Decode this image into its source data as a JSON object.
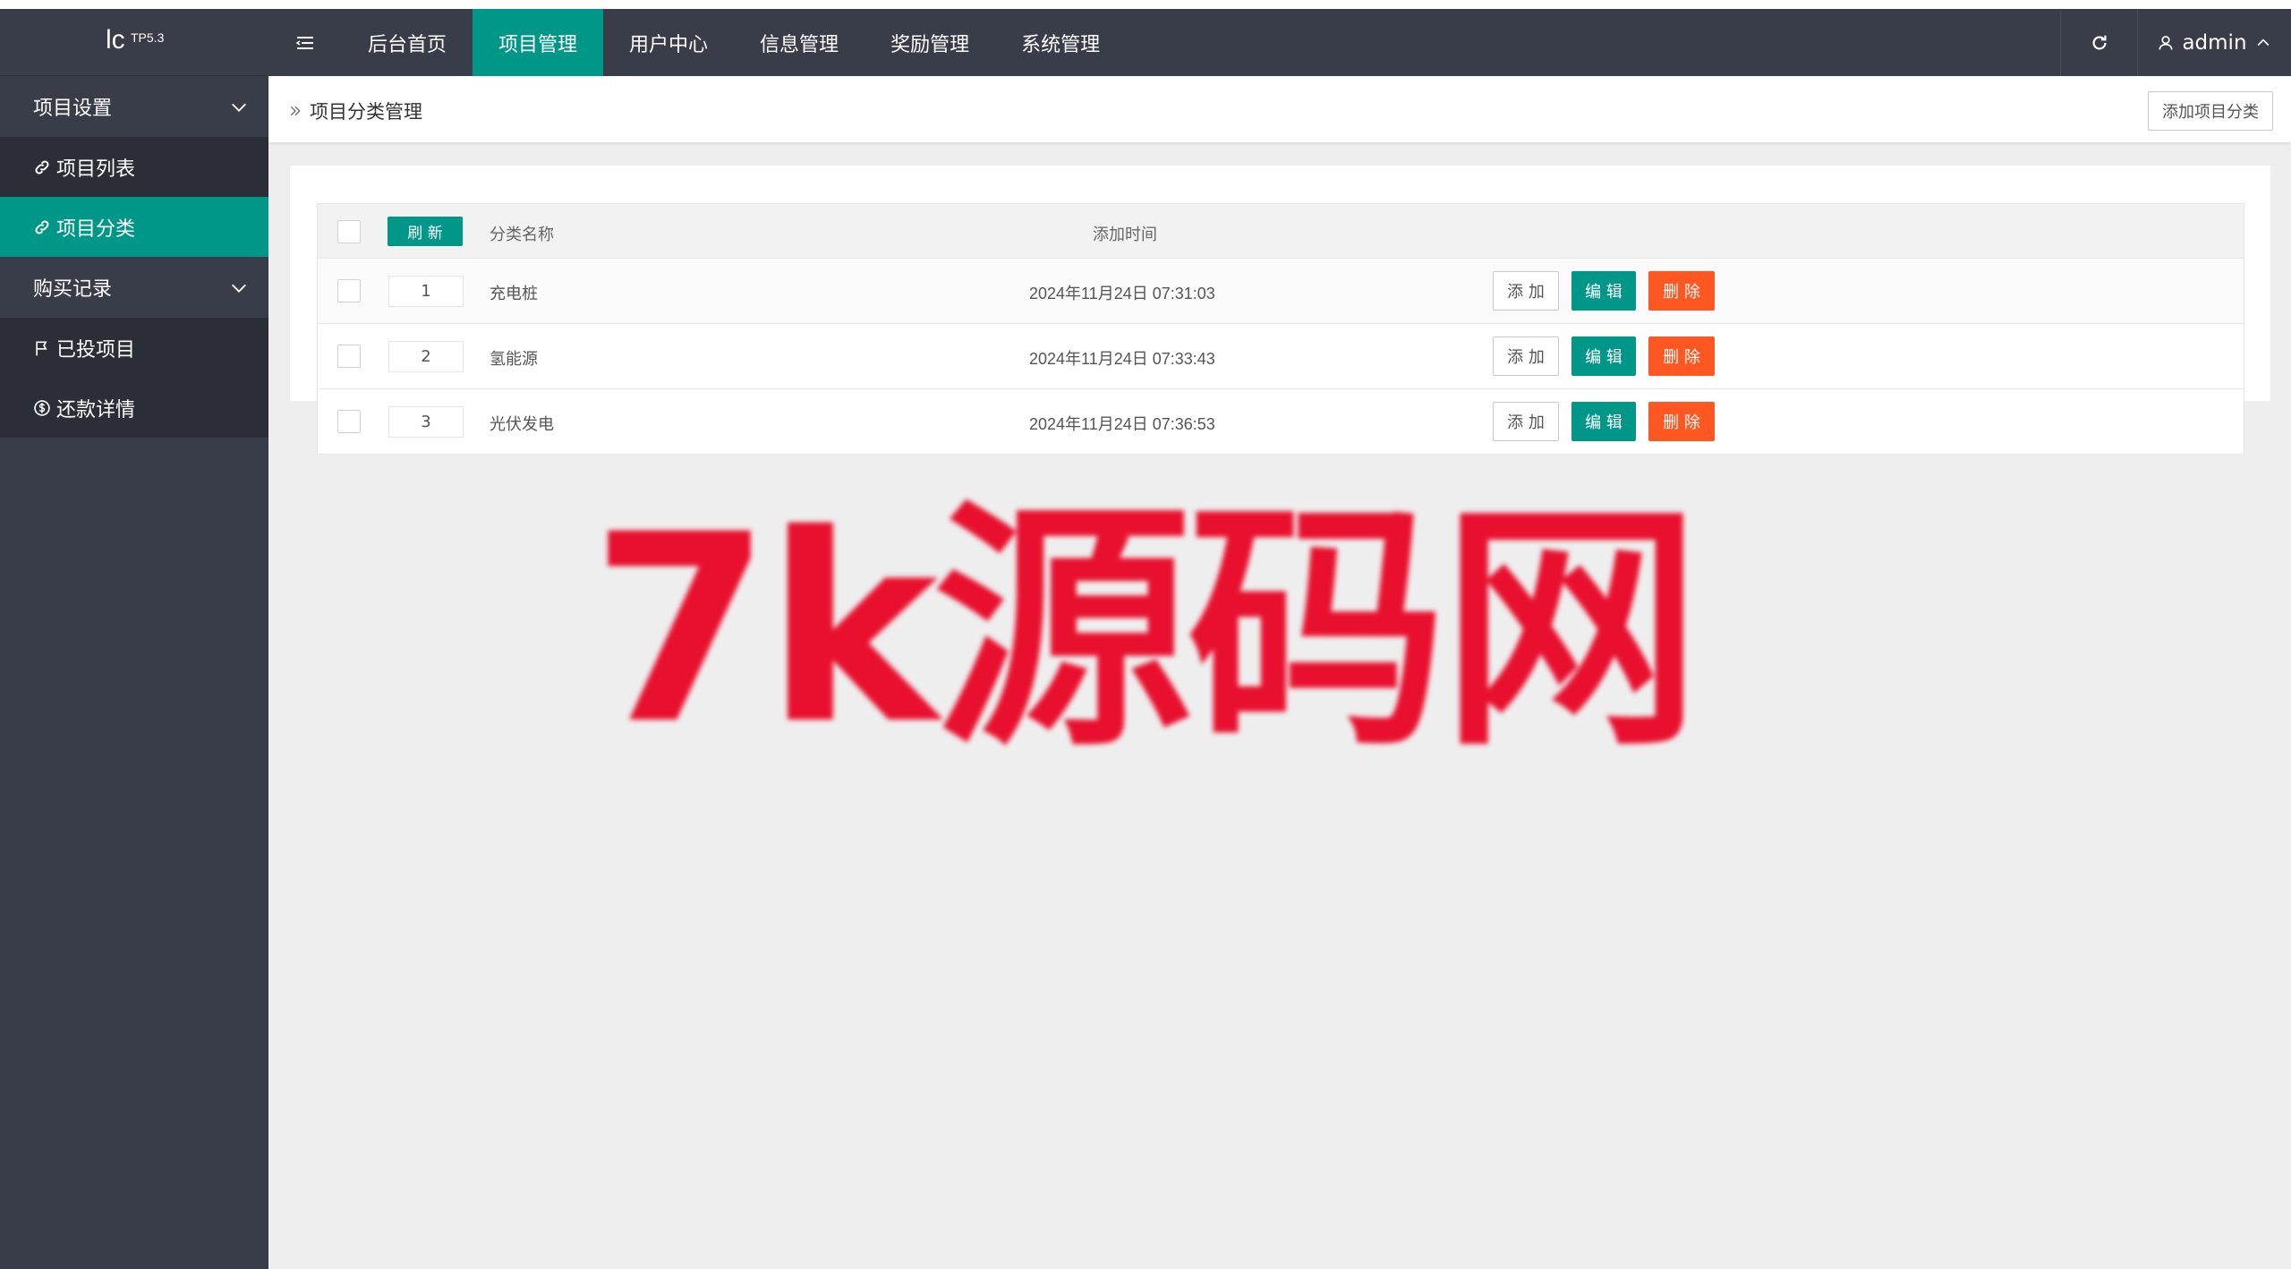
{
  "logo": {
    "main": "lc",
    "sup": "TP5.3"
  },
  "header": {
    "nav": [
      {
        "label": "后台首页",
        "active": false
      },
      {
        "label": "项目管理",
        "active": true
      },
      {
        "label": "用户中心",
        "active": false
      },
      {
        "label": "信息管理",
        "active": false
      },
      {
        "label": "奖励管理",
        "active": false
      },
      {
        "label": "系统管理",
        "active": false
      }
    ],
    "user": "admin"
  },
  "sidebar": {
    "group1": "项目设置",
    "item_list": "项目列表",
    "item_category": "项目分类",
    "group2": "购买记录",
    "invested": "已投项目",
    "repayment": "还款详情"
  },
  "breadcrumb": "项目分类管理",
  "add_category_button": "添加项目分类",
  "table": {
    "refresh_label": "刷 新",
    "col_name": "分类名称",
    "col_time": "添加时间",
    "rows": [
      {
        "sort": "1",
        "name": "充电桩",
        "time": "2024年11月24日 07:31:03"
      },
      {
        "sort": "2",
        "name": "氢能源",
        "time": "2024年11月24日 07:33:43"
      },
      {
        "sort": "3",
        "name": "光伏发电",
        "time": "2024年11月24日 07:36:53"
      }
    ],
    "actions": {
      "add": "添 加",
      "edit": "编 辑",
      "delete": "删 除"
    }
  },
  "watermark": "7k源码网",
  "colors": {
    "header_bg": "#393d49",
    "accent": "#009688",
    "danger": "#ff5722",
    "watermark": "#e8102e"
  }
}
